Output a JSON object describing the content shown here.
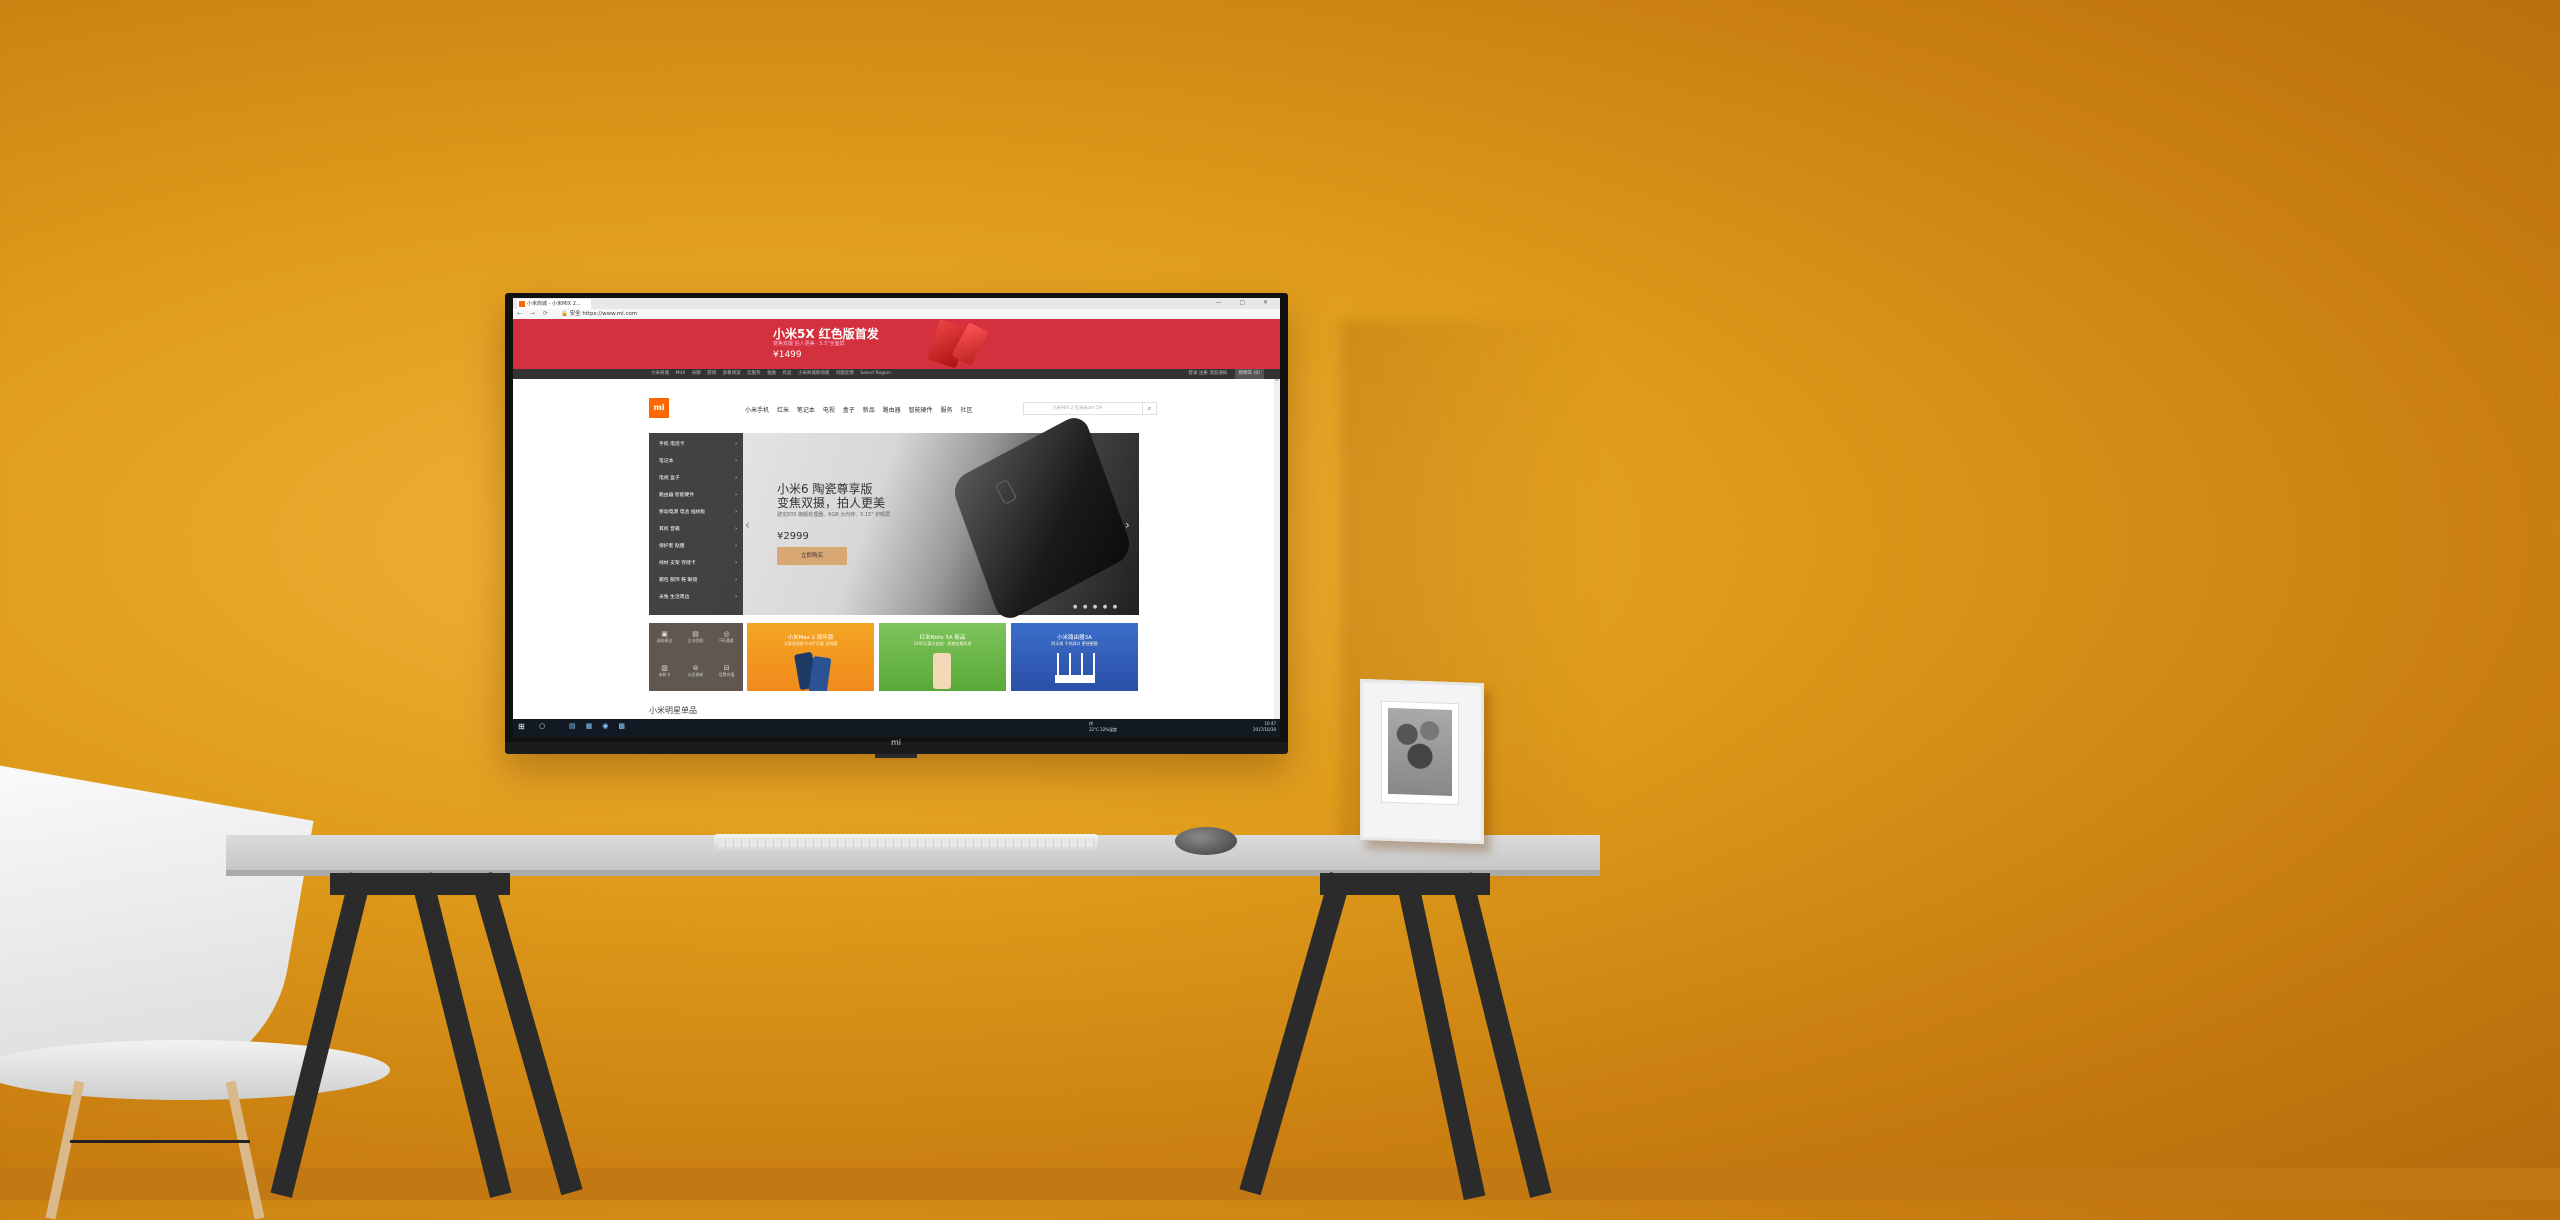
{
  "browser": {
    "tab_title": "小米商城 - 小米MIX 2...",
    "url": "https://www.mi.com",
    "url_prefix": "安全",
    "window_controls": "— ▢ ✕"
  },
  "banner": {
    "title": "小米5X 红色版首发",
    "subtitle": "变焦双摄 拍人更美 · 5.5\"全面屏",
    "price": "¥1499"
  },
  "topnav": {
    "links": [
      "小米商城",
      "MIUI",
      "米聊",
      "游戏",
      "多看阅读",
      "云服务",
      "金融",
      "有品",
      "小米商城移动版",
      "问题反馈",
      "Select Region"
    ],
    "right": [
      "登录",
      "注册",
      "消息通知"
    ],
    "cart": "购物车 (0)"
  },
  "header": {
    "logo": "mi",
    "nav": [
      "小米手机",
      "红米",
      "笔记本",
      "电视",
      "盒子",
      "新品",
      "路由器",
      "智能硬件",
      "服务",
      "社区"
    ],
    "search_placeholder": "小米MIX 2  红米Note 5A"
  },
  "sidemenu": [
    "手机 电话卡",
    "笔记本",
    "电视 盒子",
    "路由器 智能硬件",
    "移动电源 电池 插线板",
    "耳机 音箱",
    "保护套 贴膜",
    "线材 支架 存储卡",
    "箱包 服饰 鞋 眼镜",
    "米兔 生活周边"
  ],
  "hero": {
    "title": "小米6 陶瓷尊享版",
    "title2": "变焦双摄，拍人更美",
    "subtitle": "骁龙835 旗舰处理器、6GB 大内存、5.15\" 护眼屏",
    "price": "¥2999",
    "button": "立即购买"
  },
  "subgrid": [
    "选购建议",
    "企业团购",
    "F码通道",
    "米粉卡",
    "以旧换新",
    "话费充值"
  ],
  "tiles": [
    {
      "title": "小米Max 2 周年版",
      "sub": "大屏长续航 6.44\"巨屏 全网通"
    },
    {
      "title": "红米Note 5A 新品",
      "sub": "1600万柔光自拍 · 质感金属机身"
    },
    {
      "title": "小米路由器3A",
      "sub": "四天线 千兆网口 更快更稳"
    }
  ],
  "section_title": "小米明星单品",
  "taskbar": {
    "start": "⊞",
    "search": "○",
    "tray_lang": "拼",
    "tray_weather": "22°C 32%湿度",
    "time": "10:47",
    "date": "2017/10/30"
  },
  "chin_logo": "mi"
}
